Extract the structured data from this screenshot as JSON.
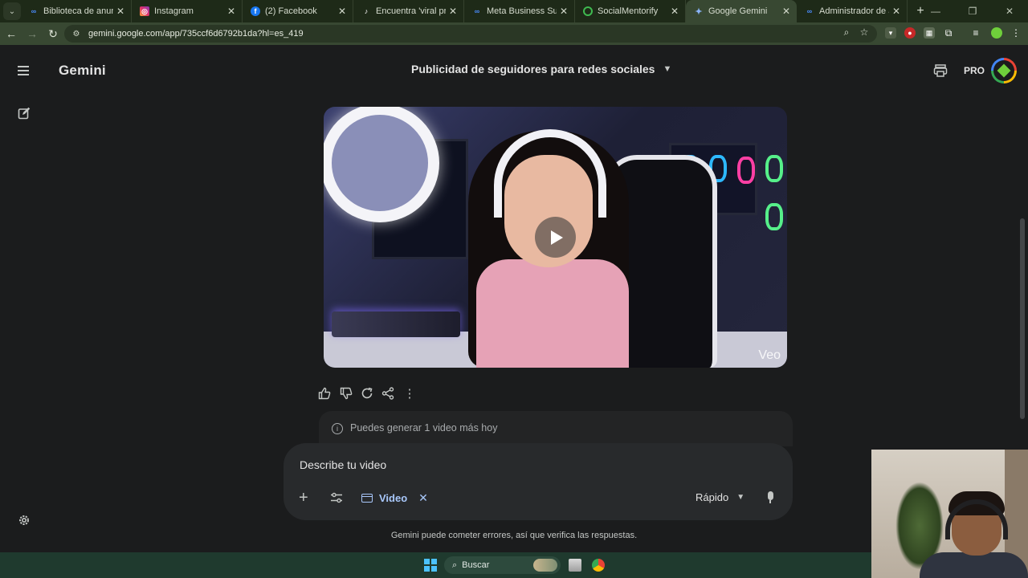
{
  "browser": {
    "tabs": [
      {
        "label": "Biblioteca de anuncios",
        "favicon": "meta-icon",
        "color": "#0866ff"
      },
      {
        "label": "Instagram",
        "favicon": "instagram-icon",
        "color": "#e1306c"
      },
      {
        "label": "(2) Facebook",
        "favicon": "facebook-icon",
        "color": "#1877f2"
      },
      {
        "label": "Encuentra 'viral pro' en Ti",
        "favicon": "tiktok-icon",
        "color": "#000000"
      },
      {
        "label": "Meta Business Suite",
        "favicon": "meta-icon",
        "color": "#0866ff"
      },
      {
        "label": "SocialMentorify",
        "favicon": "socialmentorify-icon",
        "color": "#3fb950"
      },
      {
        "label": "Google Gemini",
        "favicon": "gemini-icon",
        "color": "#8ab4f8",
        "active": true
      },
      {
        "label": "Administrador de anunc",
        "favicon": "meta-icon",
        "color": "#0866ff"
      }
    ],
    "url": "gemini.google.com/app/735ccf6d6792b1da?hl=es_419"
  },
  "app": {
    "name": "Gemini",
    "conversation_title": "Publicidad de seguidores para redes sociales",
    "plan_badge": "PRO",
    "accent": "#a8c7fa"
  },
  "video": {
    "watermark": "Veo"
  },
  "quota": {
    "text": "Puedes generar 1 video más hoy"
  },
  "composer": {
    "placeholder": "Describe tu video",
    "tool_chip": "Video",
    "mode": "Rápido"
  },
  "footer": {
    "disclaimer": "Gemini puede cometer errores, así que verifica las respuestas."
  },
  "taskbar": {
    "search_label": "Buscar"
  }
}
